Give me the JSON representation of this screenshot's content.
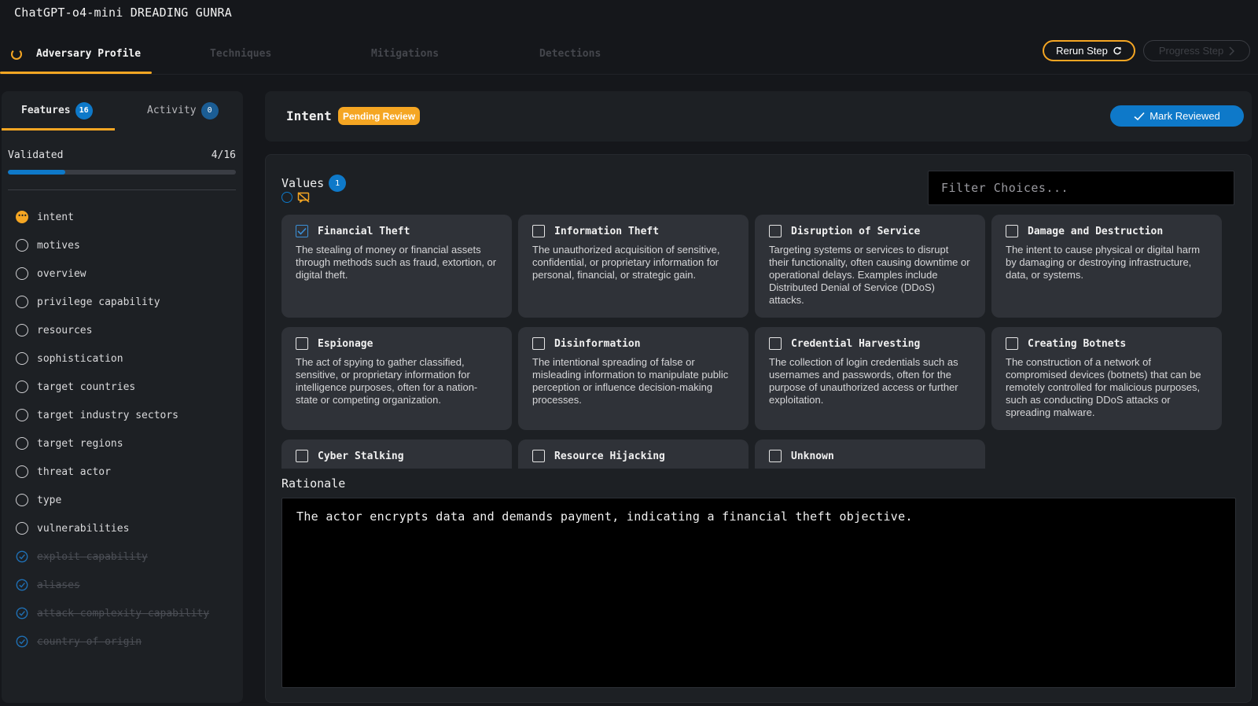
{
  "app": {
    "title": "ChatGPT-o4-mini DREADING GUNRA"
  },
  "top_tabs": [
    {
      "label": "Adversary Profile",
      "active": true
    },
    {
      "label": "Techniques",
      "active": false
    },
    {
      "label": "Mitigations",
      "active": false
    },
    {
      "label": "Detections",
      "active": false
    }
  ],
  "actions": {
    "rerun_label": "Rerun Step",
    "progress_label": "Progress Step"
  },
  "sidebar": {
    "tabs": [
      {
        "label": "Features",
        "count": "16"
      },
      {
        "label": "Activity",
        "count": "0"
      }
    ],
    "validated_label": "Validated",
    "validated_count": "4/16",
    "validated_fraction": 0.25,
    "features": [
      {
        "label": "intent",
        "status": "active"
      },
      {
        "label": "motives",
        "status": "pending"
      },
      {
        "label": "overview",
        "status": "pending"
      },
      {
        "label": "privilege capability",
        "status": "pending"
      },
      {
        "label": "resources",
        "status": "pending"
      },
      {
        "label": "sophistication",
        "status": "pending"
      },
      {
        "label": "target countries",
        "status": "pending"
      },
      {
        "label": "target industry sectors",
        "status": "pending"
      },
      {
        "label": "target regions",
        "status": "pending"
      },
      {
        "label": "threat actor",
        "status": "pending"
      },
      {
        "label": "type",
        "status": "pending"
      },
      {
        "label": "vulnerabilities",
        "status": "pending"
      },
      {
        "label": "exploit capability",
        "status": "done"
      },
      {
        "label": "aliases",
        "status": "done"
      },
      {
        "label": "attack complexity capability",
        "status": "done"
      },
      {
        "label": "country of origin",
        "status": "done"
      }
    ]
  },
  "intent": {
    "title": "Intent",
    "status_badge": "Pending Review",
    "mark_reviewed_label": "Mark Reviewed"
  },
  "values": {
    "label": "Values",
    "count": "1",
    "filter_placeholder": "Filter Choices...",
    "choices": [
      {
        "title": "Financial Theft",
        "checked": true,
        "description": "The stealing of money or financial assets through methods such as fraud, extortion, or digital theft."
      },
      {
        "title": "Information Theft",
        "checked": false,
        "description": "The unauthorized acquisition of sensitive, confidential, or proprietary information for personal, financial, or strategic gain."
      },
      {
        "title": "Disruption of Service",
        "checked": false,
        "description": "Targeting systems or services to disrupt their functionality, often causing downtime or operational delays. Examples include Distributed Denial of Service (DDoS) attacks."
      },
      {
        "title": "Damage and Destruction",
        "checked": false,
        "description": "The intent to cause physical or digital harm by damaging or destroying infrastructure, data, or systems."
      },
      {
        "title": "Espionage",
        "checked": false,
        "description": "The act of spying to gather classified, sensitive, or proprietary information for intelligence purposes, often for a nation-state or competing organization."
      },
      {
        "title": "Disinformation",
        "checked": false,
        "description": "The intentional spreading of false or misleading information to manipulate public perception or influence decision-making processes."
      },
      {
        "title": "Credential Harvesting",
        "checked": false,
        "description": "The collection of login credentials such as usernames and passwords, often for the purpose of unauthorized access or further exploitation."
      },
      {
        "title": "Creating Botnets",
        "checked": false,
        "description": "The construction of a network of compromised devices (botnets) that can be remotely controlled for malicious purposes, such as conducting DDoS attacks or spreading malware."
      },
      {
        "title": "Cyber Stalking",
        "checked": false,
        "description": ""
      },
      {
        "title": "Resource Hijacking",
        "checked": false,
        "description": ""
      },
      {
        "title": "Unknown",
        "checked": false,
        "description": ""
      }
    ]
  },
  "rationale": {
    "label": "Rationale",
    "text": "The actor encrypts data and demands payment, indicating a financial theft objective."
  },
  "colors": {
    "accent": "#f5a623",
    "primary": "#0e79c9",
    "panel": "#1d2024",
    "card": "#2f3238"
  }
}
